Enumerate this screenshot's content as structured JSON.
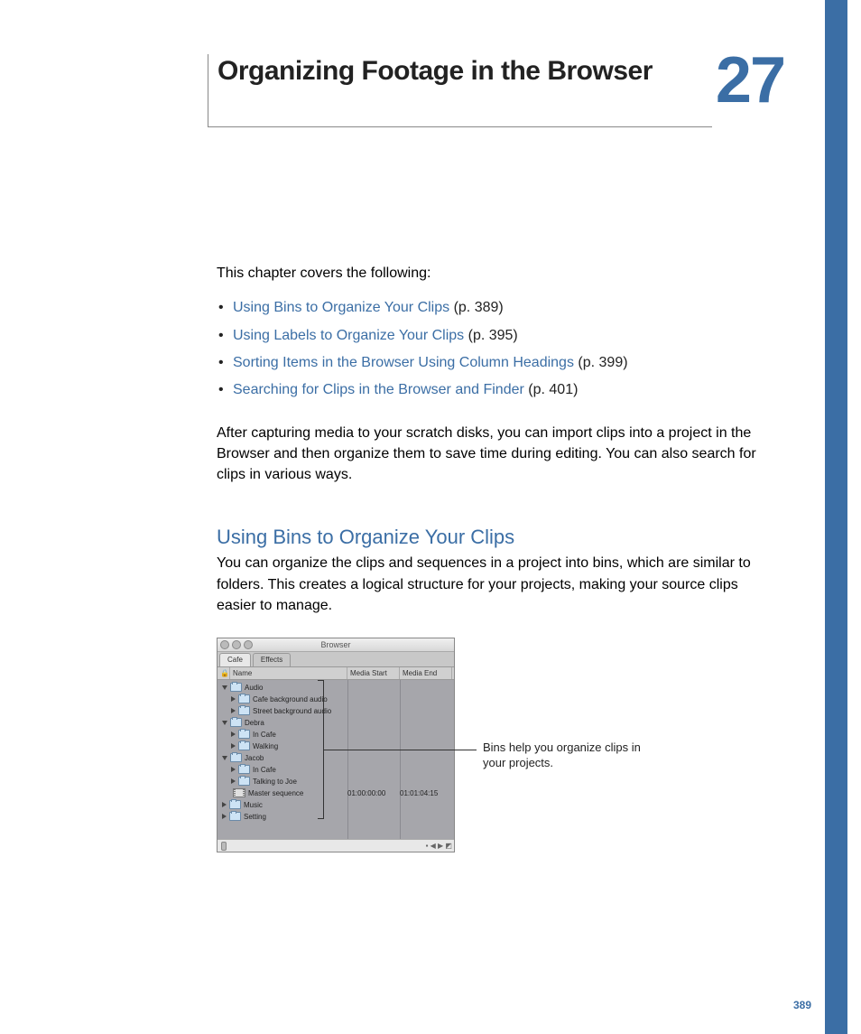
{
  "chapter": {
    "title": "Organizing Footage in the Browser",
    "number": "27"
  },
  "intro": "This chapter covers the following:",
  "toc": [
    {
      "link": "Using Bins to Organize Your Clips",
      "page": "(p. 389)"
    },
    {
      "link": "Using Labels to Organize Your Clips",
      "page": "(p. 395)"
    },
    {
      "link": "Sorting Items in the Browser Using Column Headings",
      "page": "(p. 399)"
    },
    {
      "link": "Searching for Clips in the Browser and Finder",
      "page": "(p. 401)"
    }
  ],
  "para1": "After capturing media to your scratch disks, you can import clips into a project in the Browser and then organize them to save time during editing. You can also search for clips in various ways.",
  "section": {
    "heading": "Using Bins to Organize Your Clips",
    "para": "You can organize the clips and sequences in a project into bins, which are similar to folders. This creates a logical structure for your projects, making your source clips easier to manage."
  },
  "browser": {
    "title": "Browser",
    "tabs": [
      "Cafe",
      "Effects"
    ],
    "columns": {
      "name": "Name",
      "mediaStart": "Media Start",
      "mediaEnd": "Media End"
    },
    "tree": {
      "audio": {
        "label": "Audio",
        "children": [
          "Cafe background audio",
          "Street background audio"
        ]
      },
      "debra": {
        "label": "Debra",
        "children": [
          "In Cafe",
          "Walking"
        ]
      },
      "jacob": {
        "label": "Jacob",
        "children": [
          "In Cafe",
          "Talking to Joe"
        ]
      },
      "master": {
        "label": "Master sequence",
        "mediaStart": "01:00:00:00",
        "mediaEnd": "01:01:04:15"
      },
      "music": {
        "label": "Music"
      },
      "setting": {
        "label": "Setting"
      }
    }
  },
  "callout": "Bins help you organize clips in your projects.",
  "pageNumber": "389"
}
